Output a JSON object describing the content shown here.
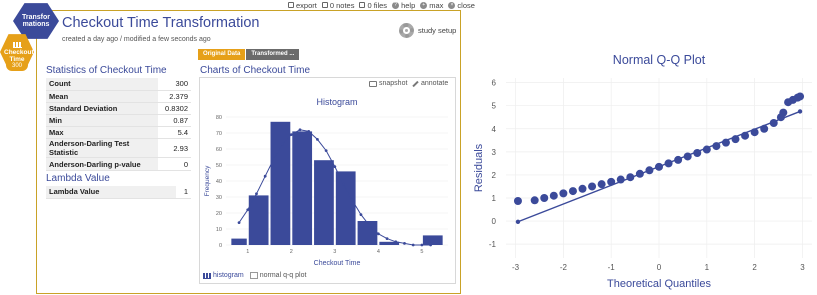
{
  "colors": {
    "accent": "#3b4a9a",
    "orange": "#e6a019",
    "bars": "#3b4a9a"
  },
  "topbar": {
    "export": "export",
    "notes": "0 notes",
    "files": "0 files",
    "help": "help",
    "max": "max",
    "close": "close"
  },
  "hex": {
    "transformations": "Transformations",
    "checkout_time": "Checkout Time",
    "count": "300"
  },
  "header": {
    "title": "Checkout Time Transformation",
    "meta": "created a day ago / modified a few seconds ago",
    "study_setup": "study setup"
  },
  "tabs": {
    "original": "Original Data",
    "transformed": "Transformed ..."
  },
  "stats": {
    "title": "Statistics of Checkout Time",
    "rows": [
      {
        "label": "Count",
        "value": "300"
      },
      {
        "label": "Mean",
        "value": "2.379"
      },
      {
        "label": "Standard Deviation",
        "value": "0.8302"
      },
      {
        "label": "Min",
        "value": "0.87"
      },
      {
        "label": "Max",
        "value": "5.4"
      },
      {
        "label": "Anderson-Darling Test Statistic",
        "value": "2.93"
      },
      {
        "label": "Anderson-Darling p-value",
        "value": "0"
      }
    ]
  },
  "lambda": {
    "title": "Lambda Value",
    "rows": [
      {
        "label": "Lambda Value",
        "value": "1"
      }
    ]
  },
  "charts": {
    "title": "Charts of Checkout Time",
    "snapshot": "snapshot",
    "annotate": "annotate",
    "tab_histogram": "histogram",
    "tab_qq": "normal q-q plot"
  },
  "chart_data": [
    {
      "type": "bar",
      "title": "Histogram",
      "xlabel": "Checkout Time",
      "ylabel": "Frequency",
      "bin_edges": [
        0.6,
        1.0,
        1.5,
        2.0,
        2.5,
        3.0,
        3.5,
        4.0,
        4.5,
        5.0,
        5.5
      ],
      "values": [
        4,
        31,
        77,
        71,
        53,
        46,
        15,
        2,
        0,
        6
      ],
      "curve": {
        "x": [
          0.8,
          1.0,
          1.2,
          1.4,
          1.6,
          1.8,
          2.0,
          2.2,
          2.4,
          2.6,
          2.8,
          3.0,
          3.2,
          3.4,
          3.6,
          3.8,
          4.0,
          4.2,
          4.4,
          4.6,
          4.8,
          5.0,
          5.2
        ],
        "y": [
          14,
          22,
          32,
          43,
          54,
          63,
          69,
          72,
          71,
          66,
          59,
          49,
          38,
          28,
          19,
          12,
          7,
          4,
          2,
          1,
          0,
          0,
          0
        ]
      },
      "xlim": [
        0.5,
        5.6
      ],
      "ylim": [
        0,
        80
      ],
      "xticks": [
        1,
        2,
        3,
        4,
        5
      ],
      "yticks": [
        0,
        10,
        20,
        30,
        40,
        50,
        60,
        70,
        80
      ]
    },
    {
      "type": "scatter",
      "title": "Normal Q-Q Plot",
      "xlabel": "Theoretical Quantiles",
      "ylabel": "Residuals",
      "xlim": [
        -3.2,
        3.2
      ],
      "ylim": [
        -1.6,
        6.2
      ],
      "xticks": [
        -3,
        -2,
        -1,
        0,
        1,
        2,
        3
      ],
      "yticks": [
        -1,
        0,
        1,
        2,
        3,
        4,
        5,
        6
      ],
      "reference_line": {
        "x": [
          -2.95,
          2.95
        ],
        "y": [
          -0.03,
          4.75
        ]
      },
      "points": {
        "x": [
          -2.95,
          -2.6,
          -2.4,
          -2.2,
          -2.0,
          -1.8,
          -1.6,
          -1.4,
          -1.2,
          -1.0,
          -0.8,
          -0.6,
          -0.4,
          -0.2,
          0.0,
          0.2,
          0.4,
          0.6,
          0.8,
          1.0,
          1.2,
          1.4,
          1.6,
          1.8,
          2.0,
          2.2,
          2.4,
          2.55,
          2.6,
          2.7,
          2.8,
          2.9,
          2.95
        ],
        "y": [
          0.87,
          0.9,
          1.0,
          1.1,
          1.2,
          1.3,
          1.4,
          1.5,
          1.6,
          1.7,
          1.8,
          1.9,
          2.05,
          2.2,
          2.35,
          2.5,
          2.65,
          2.8,
          2.95,
          3.1,
          3.25,
          3.4,
          3.55,
          3.7,
          3.85,
          4.0,
          4.25,
          4.5,
          4.7,
          5.15,
          5.25,
          5.35,
          5.4
        ]
      }
    }
  ]
}
